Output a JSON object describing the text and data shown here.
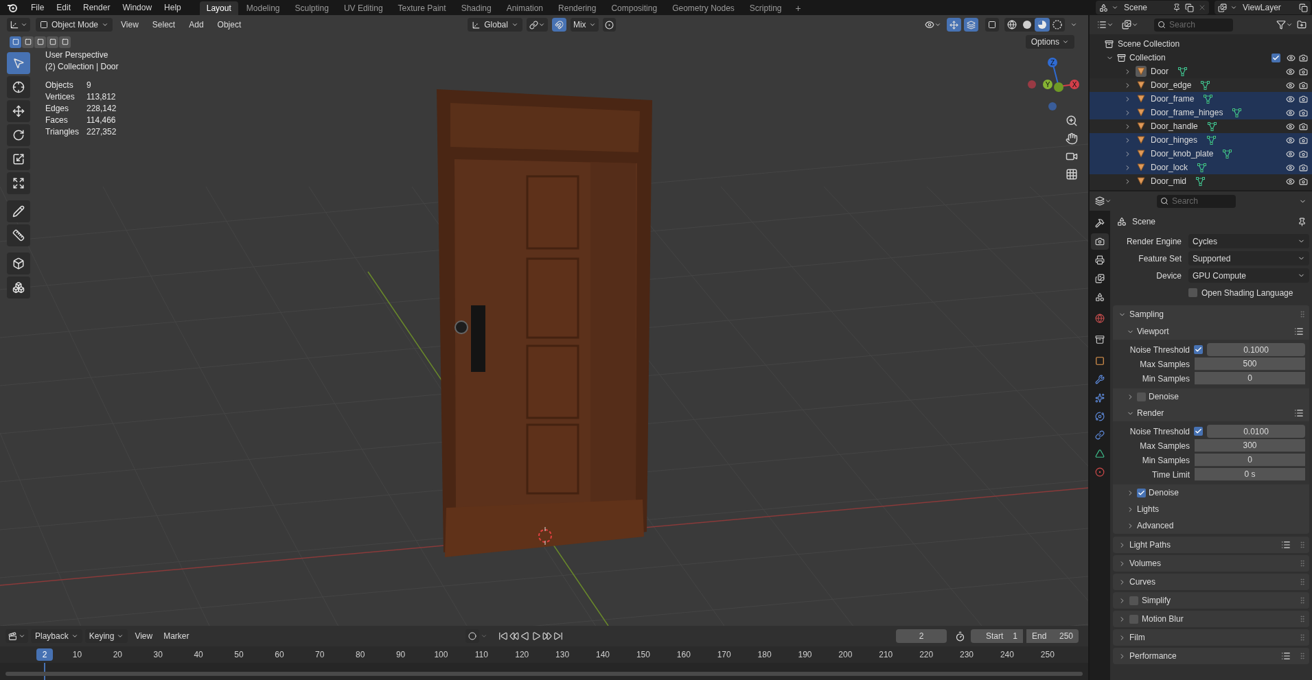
{
  "top_bar": {
    "menus": [
      "File",
      "Edit",
      "Render",
      "Window",
      "Help"
    ],
    "workspaces": [
      {
        "label": "Layout",
        "selected": true
      },
      {
        "label": "Modeling",
        "selected": false
      },
      {
        "label": "Sculpting",
        "selected": false
      },
      {
        "label": "UV Editing",
        "selected": false
      },
      {
        "label": "Texture Paint",
        "selected": false
      },
      {
        "label": "Shading",
        "selected": false
      },
      {
        "label": "Animation",
        "selected": false
      },
      {
        "label": "Rendering",
        "selected": false
      },
      {
        "label": "Compositing",
        "selected": false
      },
      {
        "label": "Geometry Nodes",
        "selected": false
      },
      {
        "label": "Scripting",
        "selected": false
      }
    ],
    "add_tab": "+",
    "scene": "Scene",
    "view_layer": "ViewLayer"
  },
  "viewport": {
    "mode": "Object Mode",
    "menus": [
      "View",
      "Select",
      "Add",
      "Object"
    ],
    "orientation": "Global",
    "proportional": "Mix",
    "shading": [
      {
        "kind": "wireframe",
        "selected": false
      },
      {
        "kind": "solid",
        "selected": false
      },
      {
        "kind": "material",
        "selected": true
      },
      {
        "kind": "rendered",
        "selected": false
      }
    ],
    "options": "Options",
    "select_modes": [
      {
        "selected": true
      },
      {
        "selected": false
      },
      {
        "selected": false
      },
      {
        "selected": false
      },
      {
        "selected": false
      }
    ],
    "tools": [
      {
        "kind": "select",
        "selected": true
      },
      {
        "kind": "cursor",
        "selected": false
      },
      {
        "kind": "move",
        "selected": false
      },
      {
        "kind": "rotate",
        "selected": false
      },
      {
        "kind": "scale",
        "selected": false
      },
      {
        "kind": "transform",
        "selected": false
      },
      {
        "kind": "annotate",
        "selected": false
      },
      {
        "kind": "measure",
        "selected": false
      },
      {
        "kind": "add",
        "selected": false
      },
      {
        "kind": "duplicate",
        "selected": false
      }
    ],
    "info": {
      "view": "User Perspective",
      "context": "(2) Collection | Door",
      "stats": [
        {
          "label": "Objects",
          "value": "9"
        },
        {
          "label": "Vertices",
          "value": "113,812"
        },
        {
          "label": "Edges",
          "value": "228,142"
        },
        {
          "label": "Faces",
          "value": "114,466"
        },
        {
          "label": "Triangles",
          "value": "227,352"
        }
      ]
    },
    "gizmo": {
      "z": "Z",
      "y": "Y",
      "x": "X"
    }
  },
  "outliner": {
    "search_placeholder": "Search",
    "root": "Scene Collection",
    "collection": {
      "name": "Collection",
      "checked": true,
      "expanded": true,
      "children": [
        {
          "name": "Door",
          "selected": false,
          "active": true
        },
        {
          "name": "Door_edge",
          "selected": false,
          "active": false
        },
        {
          "name": "Door_frame",
          "selected": true,
          "active": false
        },
        {
          "name": "Door_frame_hinges",
          "selected": true,
          "active": false
        },
        {
          "name": "Door_handle",
          "selected": false,
          "active": false
        },
        {
          "name": "Door_hinges",
          "selected": true,
          "active": false
        },
        {
          "name": "Door_knob_plate",
          "selected": true,
          "active": false
        },
        {
          "name": "Door_lock",
          "selected": true,
          "active": false
        },
        {
          "name": "Door_mid",
          "selected": false,
          "active": false
        }
      ]
    }
  },
  "properties": {
    "search_placeholder": "Search",
    "tabs": [
      {
        "kind": "tool",
        "selected": false
      },
      {
        "kind": "render",
        "selected": true
      },
      {
        "kind": "output",
        "selected": false
      },
      {
        "kind": "view_layer",
        "selected": false
      },
      {
        "kind": "scene",
        "selected": false
      },
      {
        "kind": "world",
        "selected": false
      },
      {
        "kind": "collection",
        "selected": false
      },
      {
        "kind": "object",
        "selected": false
      },
      {
        "kind": "modifiers",
        "selected": false
      },
      {
        "kind": "particles",
        "selected": false
      },
      {
        "kind": "physics",
        "selected": false
      },
      {
        "kind": "constraints",
        "selected": false
      },
      {
        "kind": "data",
        "selected": false
      },
      {
        "kind": "material",
        "selected": false
      }
    ],
    "title": "Scene",
    "settings": [
      {
        "label": "Render Engine",
        "value": "Cycles"
      },
      {
        "label": "Feature Set",
        "value": "Supported"
      },
      {
        "label": "Device",
        "value": "GPU Compute"
      }
    ],
    "osl": {
      "label": "Open Shading Language",
      "checked": false
    },
    "sampling": {
      "title": "Sampling",
      "expanded": true,
      "subpanels": [
        {
          "title": "Viewport",
          "expanded": true,
          "presets": true,
          "fields": [
            {
              "kind": "toggle",
              "label": "Noise Threshold",
              "value": "0.1000",
              "checked": true
            },
            {
              "kind": "number",
              "label": "Max Samples",
              "value": "500"
            },
            {
              "kind": "number",
              "label": "Min Samples",
              "value": "0"
            }
          ]
        },
        {
          "title": "Denoise",
          "expanded": false,
          "presets": false,
          "checked": false
        },
        {
          "title": "Render",
          "expanded": true,
          "presets": true,
          "fields": [
            {
              "kind": "toggle",
              "label": "Noise Threshold",
              "value": "0.0100",
              "checked": true
            },
            {
              "kind": "number",
              "label": "Max Samples",
              "value": "300"
            },
            {
              "kind": "number",
              "label": "Min Samples",
              "value": "0"
            },
            {
              "kind": "number",
              "label": "Time Limit",
              "value": "0 s"
            }
          ]
        },
        {
          "title": "Denoise",
          "expanded": false,
          "presets": false,
          "checked": true
        },
        {
          "title": "Lights",
          "expanded": false,
          "presets": false
        },
        {
          "title": "Advanced",
          "expanded": false,
          "presets": false
        }
      ]
    },
    "panels": [
      {
        "title": "Light Paths",
        "expanded": false,
        "presets": true
      },
      {
        "title": "Volumes",
        "expanded": false,
        "presets": false
      },
      {
        "title": "Curves",
        "expanded": false,
        "presets": false
      },
      {
        "title": "Simplify",
        "expanded": false,
        "presets": false,
        "checked": false
      },
      {
        "title": "Motion Blur",
        "expanded": false,
        "presets": false,
        "checked": false
      },
      {
        "title": "Film",
        "expanded": false,
        "presets": false
      },
      {
        "title": "Performance",
        "expanded": false,
        "presets": true
      }
    ]
  },
  "timeline": {
    "menus": [
      {
        "label": "Playback",
        "dropdown": true
      },
      {
        "label": "Keying",
        "dropdown": true
      },
      {
        "label": "View",
        "dropdown": false
      },
      {
        "label": "Marker",
        "dropdown": false
      }
    ],
    "current_frame": "2",
    "start_label": "Start",
    "start": "1",
    "end_label": "End",
    "end": "250",
    "playhead": "2",
    "ruler": [
      "10",
      "20",
      "30",
      "40",
      "50",
      "60",
      "70",
      "80",
      "90",
      "100",
      "110",
      "120",
      "130",
      "140",
      "150",
      "160",
      "170",
      "180",
      "190",
      "200",
      "210",
      "220",
      "230",
      "240",
      "250"
    ]
  }
}
